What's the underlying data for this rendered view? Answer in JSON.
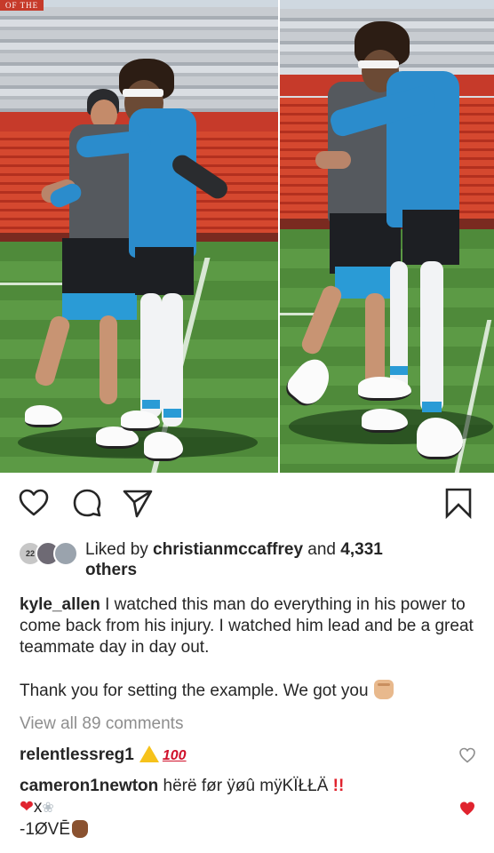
{
  "post": {
    "photo_left_alt": "",
    "photo_sign_text": "OF THE"
  },
  "actions": {
    "like": "heart-outline-icon",
    "comment": "comment-bubble-icon",
    "share": "paper-plane-icon",
    "save": "bookmark-icon"
  },
  "likes": {
    "prefix": "Liked by ",
    "user": "christianmccaffrey",
    "middle": " and ",
    "count": "4,331",
    "suffix": "others",
    "avatar1_text": "22"
  },
  "caption": {
    "username": "kyle_allen",
    "text": " I watched this man do everything in his power to come back from his injury. I watched him lead and be a great teammate day in day out.",
    "text2": "Thank you for setting the example. We got you"
  },
  "view_all": "View all 89 comments",
  "comments": [
    {
      "username": "relentlessreg1",
      "text": "",
      "hundred": "100",
      "liked": false
    },
    {
      "username": "cameron1newton",
      "text": " hërë før ÿøû mÿKÏŁŁÄ",
      "bangs": "!!",
      "line2_x": "x",
      "line3": "-1ØVĒ",
      "liked": true
    }
  ],
  "colors": {
    "text": "#262626",
    "muted": "#8e8e8e",
    "like_red": "#e0232e"
  }
}
